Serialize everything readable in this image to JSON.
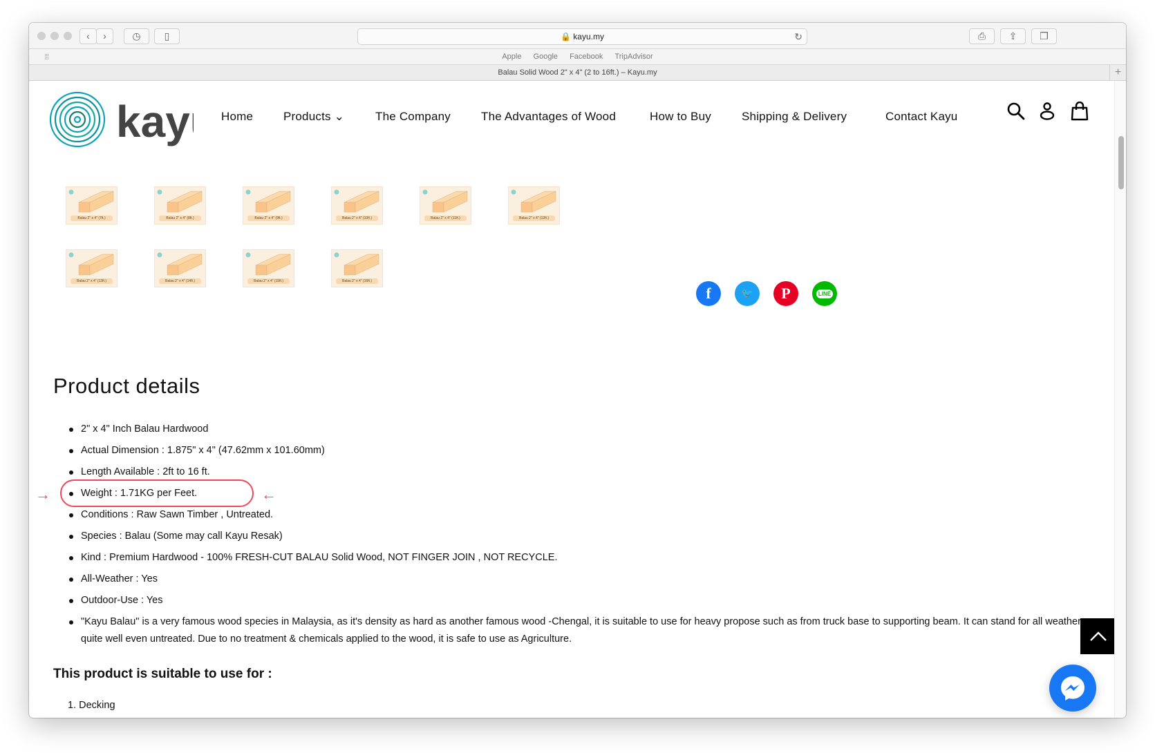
{
  "browser": {
    "url": "kayu.my",
    "tab_title": "Balau Solid Wood 2\" x 4\" (2 to 16ft.) – Kayu.my",
    "bookmarks": [
      "Apple",
      "Google",
      "Facebook",
      "TripAdvisor"
    ]
  },
  "header": {
    "logo_text": "kayu",
    "nav": [
      "Home",
      "Products",
      "The Company",
      "The Advantages of Wood",
      "How to Buy",
      "Shipping & Delivery",
      "Contact Kayu"
    ]
  },
  "thumbnails": [
    "Balau 2\" x 4\" (7ft.)",
    "Balau 2\" x 4\" (8ft.)",
    "Balau 2\" x 4\" (9ft.)",
    "Balau 2\" x 4\" (10ft.)",
    "Balau 2\" x 4\" (11ft.)",
    "Balau 2\" x 4\" (12ft.)",
    "Balau 2\" x 4\" (13ft.)",
    "Balau 2\" x 4\" (14ft.)",
    "Balau 2\" x 4\" (15ft.)",
    "Balau 2\" x 4\" (16ft.)"
  ],
  "social": [
    {
      "name": "facebook",
      "color": "#1877f2"
    },
    {
      "name": "twitter",
      "color": "#1da1f2"
    },
    {
      "name": "pinterest",
      "color": "#e60023"
    },
    {
      "name": "line",
      "color": "#00b900",
      "label": "LINE"
    }
  ],
  "details": {
    "title": "Product details",
    "items": [
      "2\" x 4\" Inch Balau Hardwood",
      "Actual Dimension : 1.875\" x 4\" (47.62mm x 101.60mm)",
      "Length  Available : 2ft to 16 ft.",
      "Weight : 1.71KG per Feet.",
      "Conditions : Raw Sawn Timber , Untreated.",
      "Species : Balau (Some may call Kayu Resak)",
      "Kind : Premium Hardwood - 100% FRESH-CUT BALAU Solid Wood, NOT FINGER JOIN , NOT RECYCLE.",
      "All-Weather : Yes",
      "Outdoor-Use : Yes",
      "\"Kayu Balau\" is a very famous wood species in Malaysia, as it's density as hard as another famous wood -Chengal, it is suitable to use for heavy propose such as from truck base to supporting beam. It can stand for all weather quite well even untreated. Due to no treatment & chemicals applied to the wood, it is safe to use as Agriculture."
    ],
    "highlighted_index": 3,
    "annotation_color": "#f0475a"
  },
  "suitable": {
    "title": "This product is suitable to use for :",
    "items": [
      "1.  Decking"
    ]
  }
}
